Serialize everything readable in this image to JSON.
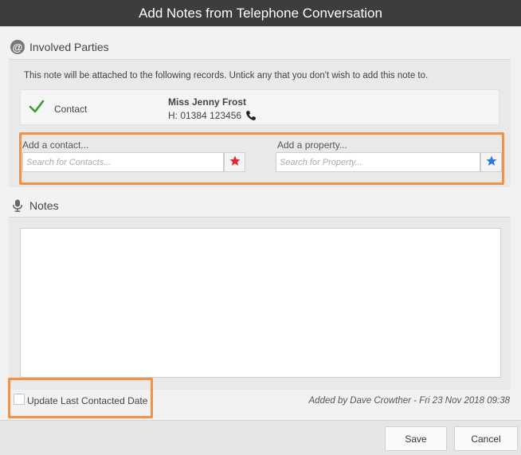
{
  "dialog": {
    "title": "Add Notes from Telephone Conversation"
  },
  "involved_parties": {
    "heading": "Involved Parties",
    "icon": "at-icon",
    "info_text": "This note will be attached to the following records. Untick any that you don't wish to add this note to.",
    "records": [
      {
        "checked": true,
        "type": "Contact",
        "name": "Miss Jenny Frost",
        "phone": "H: 01384 123456"
      }
    ],
    "add_contact": {
      "label": "Add a contact...",
      "placeholder": "Search for Contacts...",
      "star_color": "#e3242b"
    },
    "add_property": {
      "label": "Add a property...",
      "placeholder": "Search for Property...",
      "star_color": "#2a7bd6"
    }
  },
  "notes": {
    "heading": "Notes",
    "icon": "microphone-icon",
    "value": ""
  },
  "footer_bar": {
    "update_last_contacted": {
      "label": "Update Last Contacted Date",
      "checked": false
    },
    "added_by": "Added by Dave Crowther - Fri 23 Nov 2018 09:38"
  },
  "buttons": {
    "save": "Save",
    "cancel": "Cancel"
  },
  "colors": {
    "titlebar": "#3d3d3d",
    "highlight": "#f0934a",
    "check": "#3a9a2f"
  }
}
